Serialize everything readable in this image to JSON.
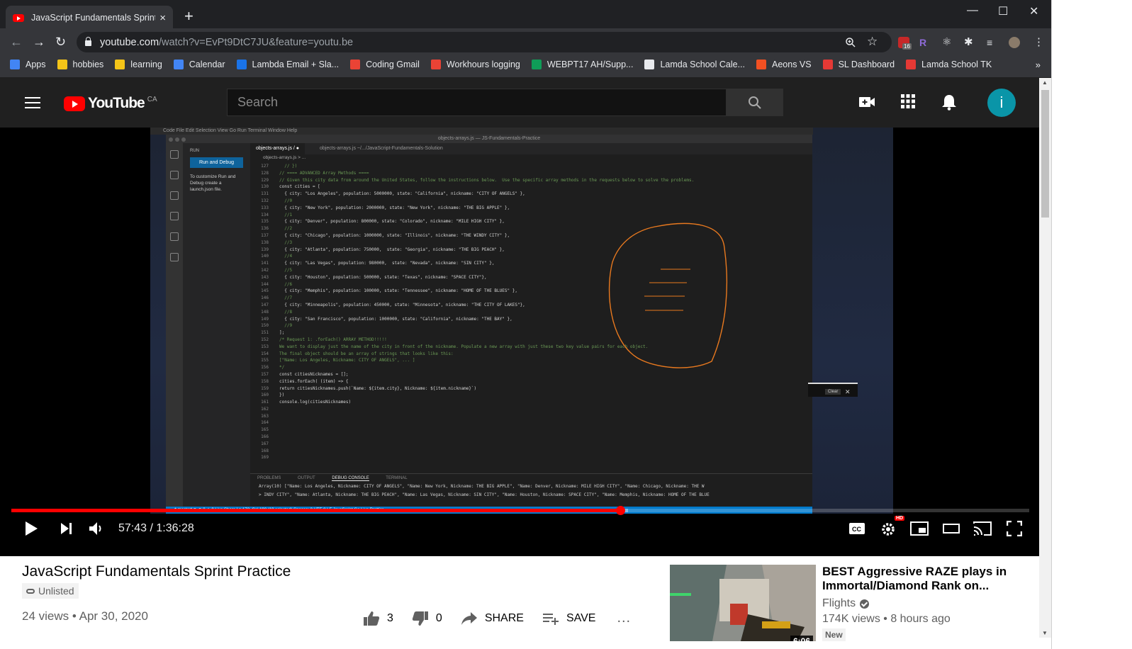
{
  "browser": {
    "tab_title": "JavaScript Fundamentals Sprint P",
    "tab_close": "×",
    "new_tab": "+",
    "window_controls": {
      "minimize": "—",
      "maximize": "☐",
      "close": "✕"
    },
    "url_host": "youtube.com",
    "url_rest": "/watch?v=EvPt9DtC7JU&feature=youtu.be",
    "bookmarks": [
      {
        "label": "Apps",
        "color": "#4285f4"
      },
      {
        "label": "hobbies",
        "color": "#f5c518"
      },
      {
        "label": "learning",
        "color": "#f5c518"
      },
      {
        "label": "Calendar",
        "color": "#4285f4"
      },
      {
        "label": "Lambda Email + Sla...",
        "color": "#1a73e8"
      },
      {
        "label": "Coding Gmail",
        "color": "#ea4335"
      },
      {
        "label": "Workhours logging",
        "color": "#ea4335"
      },
      {
        "label": "WEBPT17 AH/Supp...",
        "color": "#0f9d58"
      },
      {
        "label": "Lamda School Cale...",
        "color": "#e8eaed"
      },
      {
        "label": "Aeons VS",
        "color": "#f25022"
      },
      {
        "label": "SL Dashboard",
        "color": "#e53935"
      },
      {
        "label": "Lamda School TK",
        "color": "#e53935"
      }
    ],
    "bookmarks_more": "»",
    "ext_badge": "16"
  },
  "youtube": {
    "logo_text": "YouTube",
    "region": "CA",
    "search_placeholder": "Search",
    "avatar_letter": "i"
  },
  "player": {
    "time": "57:43 / 1:36:28",
    "progress_played": 0.598,
    "progress_loaded": 0.606,
    "hd_label": "HD",
    "vscode": {
      "menubar": "Code   File   Edit   Selection   View   Go   Run   Terminal   Window   Help",
      "window_title": "objects-arrays.js — JS-Fundamentals-Practice",
      "sidebar_label": "RUN",
      "run_button": "Run and Debug",
      "sidebar_hint": "To customize Run and Debug create a launch.json file.",
      "tabs": [
        "objects-arrays.js  /  ●",
        "objects-arrays.js  ~/.../JavaScript-Fundamentals-Solution"
      ],
      "breadcrumb": "objects-arrays.js > ...",
      "panel_tabs": [
        "PROBLEMS",
        "OUTPUT",
        "DEBUG CONSOLE",
        "TERMINAL"
      ],
      "panel_output": [
        "Array(10) [\"Name: Los Angeles, Nickname: CITY OF ANGELS\", \"Name: New York, Nickname: THE BIG APPLE\", \"Name: Denver, Nickname: MILE HIGH CITY\", \"Name: Chicago, Nickname: THE W",
        "> INDY CITY\", \"Name: Atlanta, Nickname: THE BIG PEACH\", \"Name: Las Vegas, Nickname: SIN CITY\", \"Name: Houston, Nickname: SPACE CITY\", \"Name: Memphis, Nickname: HOME OF THE BLUE"
      ],
      "status": "⎇ master*   ⟳   ⊗ 0 ⚠ 0      Live Share                                                                Ln 172, Col 190 (19 selected)   Spaces: 2   UTF-8   LF   JavaScript   Go Live   Prettier",
      "clear_label": "Clear",
      "lines": [
        {
          "n": "127",
          "t": "  // })"
        },
        {
          "n": "128",
          "t": ""
        },
        {
          "n": "129",
          "t": ""
        },
        {
          "n": "130",
          "t": "// ==== ADVANCED Array Methods ===="
        },
        {
          "n": "131",
          "t": ""
        },
        {
          "n": "132",
          "t": "// Given this city data from around the United States, follow the instructions below.  Use the specific array methods in the requests below to solve the problems."
        },
        {
          "n": "133",
          "t": ""
        },
        {
          "n": "134",
          "t": "const cities = ["
        },
        {
          "n": "135",
          "t": "  { city: \"Los Angeles\", population: 5000000, state: \"California\", nickname: \"CITY OF ANGELS\" },"
        },
        {
          "n": "136",
          "t": "  //0"
        },
        {
          "n": "137",
          "t": "  { city: \"New York\", population: 2000000, state: \"New York\", nickname: \"THE BIG APPLE\" },"
        },
        {
          "n": "138",
          "t": "  //1"
        },
        {
          "n": "139",
          "t": "  { city: \"Denver\", population: 800000, state: \"Colorado\", nickname: \"MILE HIGH CITY\" },"
        },
        {
          "n": "140",
          "t": "  //2"
        },
        {
          "n": "141",
          "t": "  { city: \"Chicago\", population: 1000000, state: \"Illinois\", nickname: \"THE WINDY CITY\" },"
        },
        {
          "n": "142",
          "t": "  //3"
        },
        {
          "n": "143",
          "t": "  { city: \"Atlanta\", population: 750000,  state: \"Georgia\", nickname: \"THE BIG PEACH\" },"
        },
        {
          "n": "144",
          "t": "  //4"
        },
        {
          "n": "145",
          "t": "  { city: \"Las Vegas\", population: 980000,  state: \"Nevada\", nickname: \"SIN CITY\" },"
        },
        {
          "n": "146",
          "t": "  //5"
        },
        {
          "n": "147",
          "t": "  { city: \"Houston\", population: 500000, state: \"Texas\", nickname: \"SPACE CITY\"},"
        },
        {
          "n": "148",
          "t": "  //6"
        },
        {
          "n": "149",
          "t": "  { city: \"Memphis\", population: 100000, state: \"Tennessee\", nickname: \"HOME OF THE BLUES\" },"
        },
        {
          "n": "150",
          "t": "  //7"
        },
        {
          "n": "151",
          "t": "  { city: \"Minneapolis\", population: 450000, state: \"Minnesota\", nickname: \"THE CITY OF LAKES\"},"
        },
        {
          "n": "152",
          "t": "  //8"
        },
        {
          "n": "153",
          "t": "  { city: \"San Francisco\", population: 1000000, state: \"California\", nickname: \"THE BAY\" },"
        },
        {
          "n": "154",
          "t": "  //9"
        },
        {
          "n": "155",
          "t": "];"
        },
        {
          "n": "156",
          "t": ""
        },
        {
          "n": "157",
          "t": "/* Request 1: .forEach() ARRAY METHOD!!!!!"
        },
        {
          "n": "158",
          "t": ""
        },
        {
          "n": "159",
          "t": "We want to display just the name of the city in front of the nickname. Populate a new array with just these two key value pairs for each object."
        },
        {
          "n": "160",
          "t": "The final object should be an array of strings that looks like this:"
        },
        {
          "n": "161",
          "t": "[\"Name: Los Angeles, Nickname: CITY OF ANGELS\", ... ]"
        },
        {
          "n": "162",
          "t": ""
        },
        {
          "n": "163",
          "t": "*/"
        },
        {
          "n": "164",
          "t": "const citiesNicknames = [];"
        },
        {
          "n": "165",
          "t": "cities.forEach( (item) => {"
        },
        {
          "n": "166",
          "t": "return citiesNicknames.push(`Name: ${item.city}, Nickname: ${item.nickname}`)"
        },
        {
          "n": "167",
          "t": "})"
        },
        {
          "n": "168",
          "t": "console.log(citiesNicknames)"
        },
        {
          "n": "169",
          "t": ""
        }
      ]
    }
  },
  "video": {
    "title": "JavaScript Fundamentals Sprint Practice",
    "visibility": "Unlisted",
    "views_date": "24 views • Apr 30, 2020",
    "likes": "3",
    "dislikes": "0",
    "share_label": "SHARE",
    "save_label": "SAVE",
    "more": "..."
  },
  "recommendation": {
    "title": "BEST Aggressive RAZE plays in Immortal/Diamond Rank on...",
    "channel": "Flights",
    "meta": "174K views • 8 hours ago",
    "badge": "New",
    "duration": "6:06"
  }
}
